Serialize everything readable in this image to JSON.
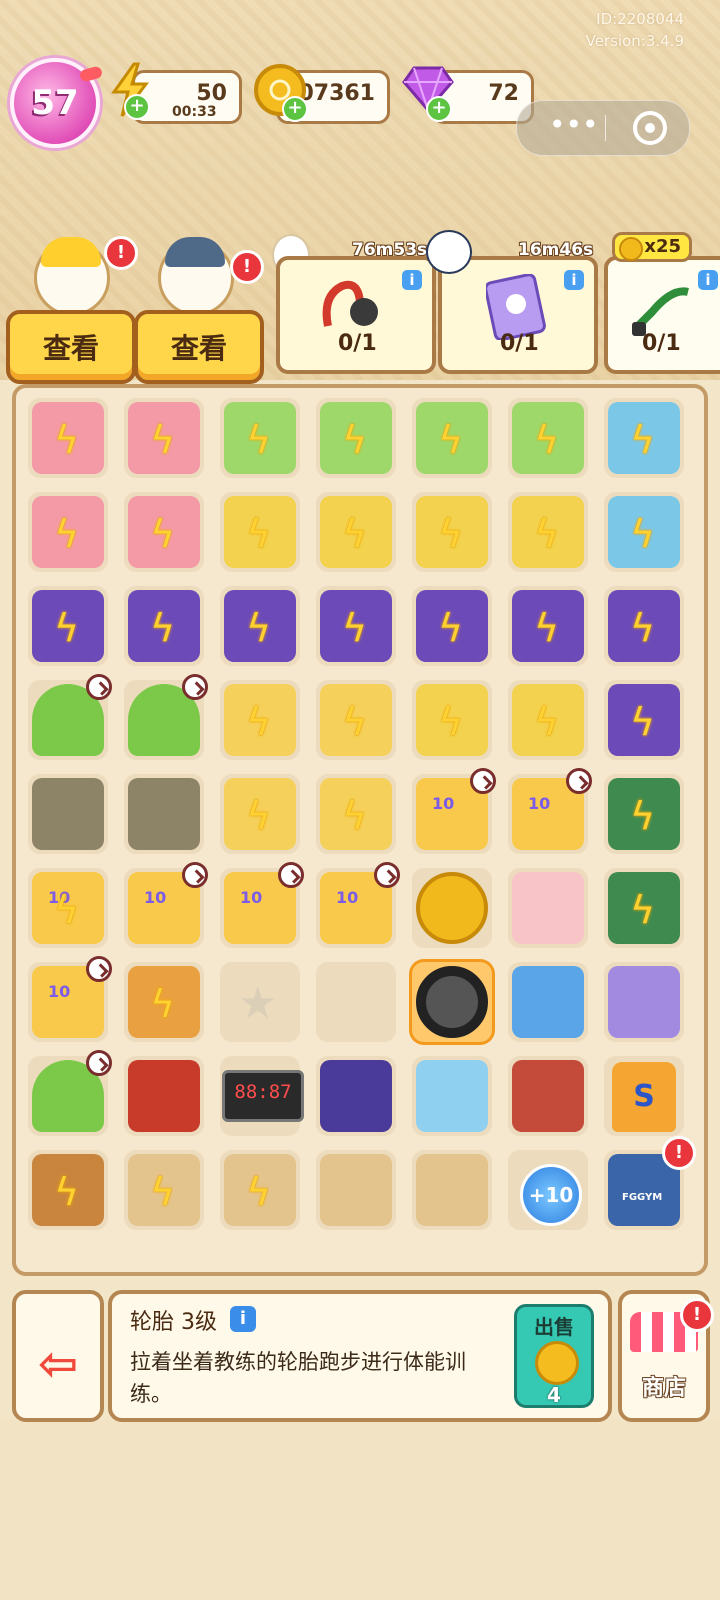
{
  "header": {
    "id_text": "ID:2208044",
    "version_text": "Version:3.4.9"
  },
  "player": {
    "level": "57"
  },
  "resources": {
    "energy": {
      "value": "50",
      "timer": "00:33",
      "icon": "lightning-icon"
    },
    "coins": {
      "value": "107361",
      "icon": "coin-icon"
    },
    "gems": {
      "value": "72",
      "icon": "gem-icon"
    }
  },
  "characters": [
    {
      "button_label": "查看",
      "alert": "!"
    },
    {
      "button_label": "查看",
      "alert": "!"
    }
  ],
  "orders": [
    {
      "timer": "76m53s",
      "progress": "0/1",
      "item": "resistance-band"
    },
    {
      "timer": "16m46s",
      "progress": "0/1",
      "item": "fitness-card"
    },
    {
      "reward": "x25",
      "progress": "0/1",
      "item": "jump-rope"
    }
  ],
  "board": {
    "bolt_glyph": "ϟ",
    "star_glyph": "★",
    "bonus_label": "+10",
    "scoreboard_text": "88:87",
    "jersey_letter": "S",
    "jersey_number": "10",
    "backpack_text": "FGGYM"
  },
  "selected_item": {
    "name": "轮胎",
    "level": "3级",
    "info": "i",
    "description": "拉着坐着教练的轮胎跑步进行体能训练。",
    "sell_label": "出售",
    "sell_price": "4"
  },
  "shop": {
    "label": "商店",
    "alert": "!"
  }
}
